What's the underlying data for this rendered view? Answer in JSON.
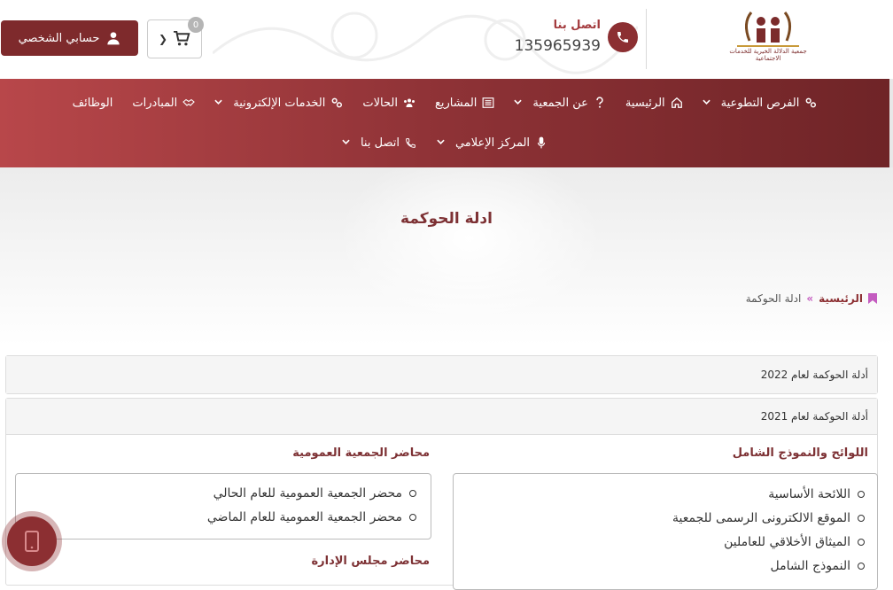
{
  "header": {
    "logo_text": "جمعية الدلالة الخيرية للخدمات الاجتماعية",
    "contact_label": "اتصل بنا",
    "contact_number": "135965939",
    "cart_count": "0",
    "account_label": "حسابي الشخصي"
  },
  "nav": {
    "row1": [
      {
        "label": "الفرص التطوعية",
        "icon": "cogs-icon",
        "has_dropdown": true
      },
      {
        "label": "الرئيسية",
        "icon": "home-icon",
        "has_dropdown": false
      },
      {
        "label": "عن الجمعية",
        "icon": "question-icon",
        "has_dropdown": true
      },
      {
        "label": "المشاريع",
        "icon": "list-icon",
        "has_dropdown": false
      },
      {
        "label": "الحالات",
        "icon": "users-icon",
        "has_dropdown": false
      },
      {
        "label": "الخدمات الإلكترونية",
        "icon": "cogs-icon",
        "has_dropdown": true
      },
      {
        "label": "المبادرات",
        "icon": "handshake-icon",
        "has_dropdown": false
      },
      {
        "label": "الوظائف",
        "icon": "",
        "has_dropdown": false
      }
    ],
    "row2": [
      {
        "label": "المركز الإعلامي",
        "icon": "microphone-icon",
        "has_dropdown": true
      },
      {
        "label": "اتصل بنا",
        "icon": "phone-icon",
        "has_dropdown": true
      }
    ]
  },
  "hero": {
    "title": "ادلة الحوكمة"
  },
  "breadcrumb": {
    "home": "الرئيسية",
    "separator": "»",
    "current": "ادلة الحوكمة"
  },
  "panels": {
    "p2022": "أدلة الحوكمة لعام 2022",
    "p2021": "أدلة الحوكمة لعام 2021"
  },
  "sections": {
    "regulations_title": "اللوائح والنموذج الشامل",
    "regulations_items": [
      "اللائحة الأساسية",
      "الموقع الالكترونى الرسمى للجمعية",
      "الميثاق الأخلاقي للعاملين",
      "النموذج الشامل"
    ],
    "general_assembly_title": "محاضر الجمعية العمومية",
    "general_assembly_items": [
      "محضر الجمعية العمومية للعام الحالي",
      "محضر الجمعية العمومية للعام الماضي"
    ],
    "board_title": "محاضر مجلس الإدارة"
  },
  "colors": {
    "brand": "#8c2f32",
    "nav_gradient_start": "#b8474a",
    "nav_gradient_end": "#6f2427"
  }
}
